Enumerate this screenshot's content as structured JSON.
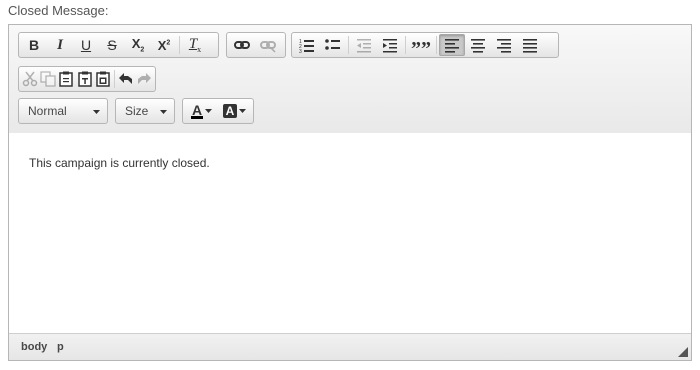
{
  "field_label": "Closed Message:",
  "toolbar": {
    "format_combo": {
      "value": "Normal"
    },
    "size_combo": {
      "value": "Size"
    },
    "buttons": {
      "bold": "B",
      "italic": "I",
      "underline": "U",
      "strike": "S",
      "subscript_base": "X",
      "subscript_mark": "2",
      "superscript_base": "X",
      "superscript_mark": "2",
      "remove_format_base": "T",
      "remove_format_mark": "x",
      "quote": "””",
      "text_color_letter": "A",
      "bg_color_letter": "A"
    },
    "active_alignment": "align-left"
  },
  "content": {
    "text": "This campaign is currently closed."
  },
  "elements_path": [
    "body",
    "p"
  ]
}
